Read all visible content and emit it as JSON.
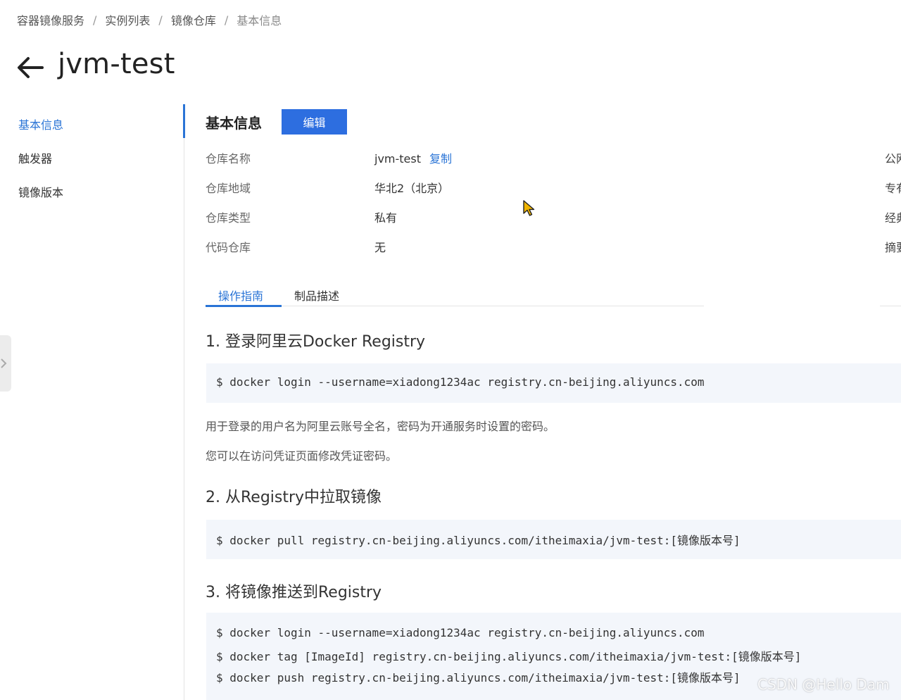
{
  "breadcrumb": {
    "items": [
      "容器镜像服务",
      "实例列表",
      "镜像仓库",
      "基本信息"
    ],
    "separator": "/"
  },
  "header": {
    "title": "jvm-test"
  },
  "sidebar": {
    "items": [
      {
        "label": "基本信息",
        "active": true
      },
      {
        "label": "触发器"
      },
      {
        "label": "镜像版本"
      }
    ]
  },
  "basic_info": {
    "title": "基本信息",
    "edit_label": "编辑",
    "fields": [
      {
        "label": "仓库名称",
        "value": "jvm-test",
        "action": "复制"
      },
      {
        "label": "仓库地域",
        "value": "华北2（北京）"
      },
      {
        "label": "仓库类型",
        "value": "私有"
      },
      {
        "label": "代码仓库",
        "value": "无"
      }
    ],
    "right_column": [
      "公网",
      "专有",
      "经典",
      "摘要"
    ]
  },
  "tabs": [
    {
      "label": "操作指南",
      "active": true
    },
    {
      "label": "制品描述"
    }
  ],
  "guide": {
    "step1": {
      "title": "1. 登录阿里云Docker Registry",
      "commands": [
        "$ docker login --username=xiadong1234ac registry.cn-beijing.aliyuncs.com"
      ],
      "notes": [
        "用于登录的用户名为阿里云账号全名，密码为开通服务时设置的密码。",
        "您可以在访问凭证页面修改凭证密码。"
      ]
    },
    "step2": {
      "title": "2. 从Registry中拉取镜像",
      "commands": [
        "$ docker pull registry.cn-beijing.aliyuncs.com/itheimaxia/jvm-test:[镜像版本号]"
      ]
    },
    "step3": {
      "title": "3. 将镜像推送到Registry",
      "commands": [
        "$ docker login --username=xiadong1234ac registry.cn-beijing.aliyuncs.com",
        "$ docker tag [ImageId] registry.cn-beijing.aliyuncs.com/itheimaxia/jvm-test:[镜像版本号]",
        "$ docker push registry.cn-beijing.aliyuncs.com/itheimaxia/jvm-test:[镜像版本号]"
      ]
    }
  },
  "watermark": "CSDN @Hello Dam",
  "colors": {
    "accent": "#2a74d6",
    "button": "#2d6ee0",
    "code_bg": "#f3f6fb"
  },
  "icons": {
    "back": "arrow-left-icon",
    "edge": "chevron-right-icon",
    "cursor": "mouse-pointer-icon"
  }
}
